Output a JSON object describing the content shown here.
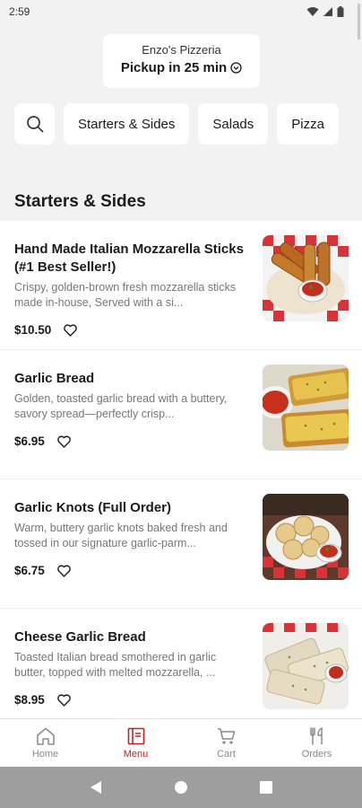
{
  "status_bar": {
    "time": "2:59"
  },
  "store": {
    "name": "Enzo's Pizzeria",
    "pickup": "Pickup in 25 min"
  },
  "categories": [
    "Starters & Sides",
    "Salads",
    "Pizza"
  ],
  "section_title": "Starters & Sides",
  "items": [
    {
      "name": "Hand Made Italian Mozzarella Sticks (#1 Best Seller!)",
      "description": "Crispy, golden-brown fresh mozzarella sticks made in-house,  Served with a si...",
      "price": "$10.50",
      "image": "mozzarella-sticks"
    },
    {
      "name": "Garlic Bread",
      "description": "Golden, toasted garlic bread with a buttery, savory spread—perfectly crisp...",
      "price": "$6.95",
      "image": "garlic-bread"
    },
    {
      "name": "Garlic Knots (Full Order)",
      "description": "Warm, buttery garlic knots baked fresh and tossed in our signature garlic-parm...",
      "price": "$6.75",
      "image": "garlic-knots"
    },
    {
      "name": "Cheese Garlic Bread",
      "description": "Toasted Italian bread smothered in garlic butter, topped with melted mozzarella, ...",
      "price": "$8.95",
      "image": "cheese-garlic-bread"
    }
  ],
  "bottom_nav": [
    {
      "label": "Home",
      "icon": "home-icon",
      "active": false
    },
    {
      "label": "Menu",
      "icon": "menu-icon",
      "active": true
    },
    {
      "label": "Cart",
      "icon": "cart-icon",
      "active": false
    },
    {
      "label": "Orders",
      "icon": "orders-icon",
      "active": false
    }
  ],
  "colors": {
    "accent": "#c8201f",
    "background": "#f2f2f2",
    "card": "#ffffff",
    "muted_text": "#777777"
  }
}
